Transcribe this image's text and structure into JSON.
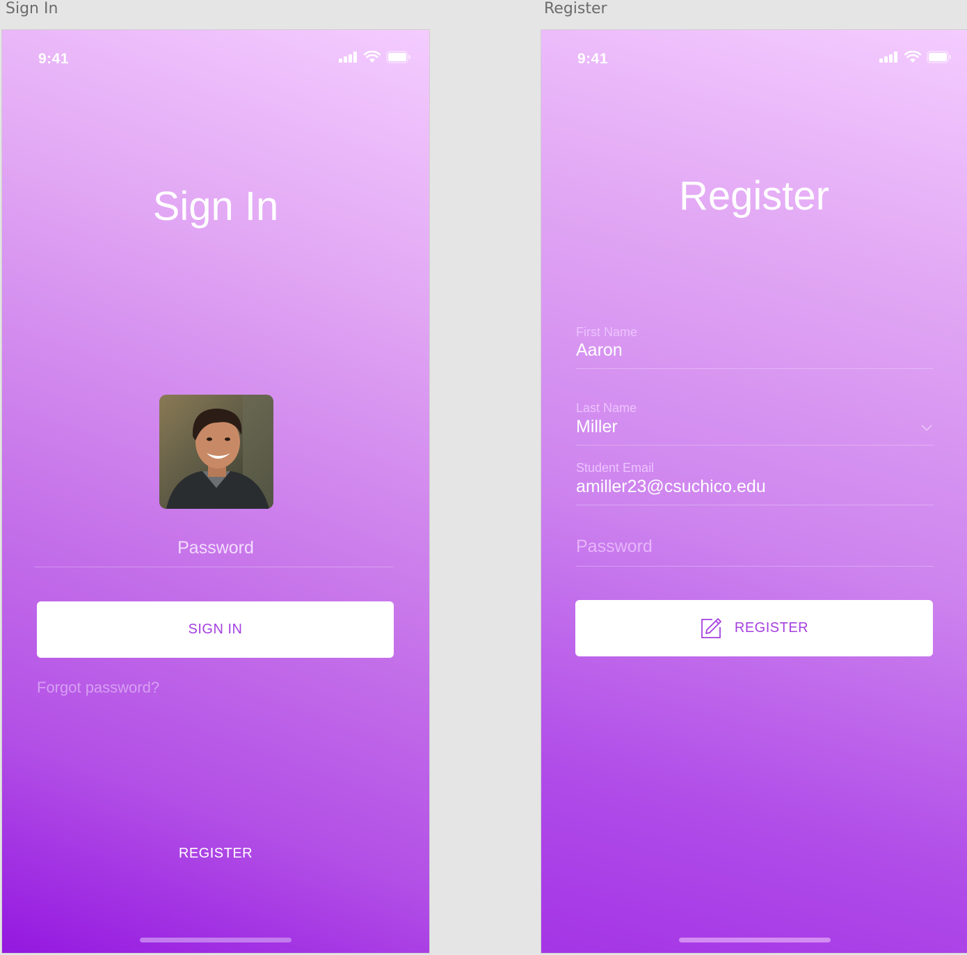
{
  "artboards": {
    "signin_label": "Sign In",
    "register_label": "Register"
  },
  "status_bar": {
    "time": "9:41"
  },
  "signin": {
    "title": "Sign In",
    "password_placeholder": "Password",
    "sign_in_button": "SIGN IN",
    "forgot_link": "Forgot password?",
    "register_link": "REGISTER"
  },
  "register": {
    "title": "Register",
    "first_name": {
      "label": "First Name",
      "value": "Aaron"
    },
    "last_name": {
      "label": "Last Name",
      "value": "Miller"
    },
    "email": {
      "label": "Student Email",
      "value": "amiller23@csuchico.edu"
    },
    "password_placeholder": "Password",
    "register_button": "REGISTER"
  },
  "colors": {
    "accent": "#a43fe0",
    "gradient_top": "#f4ccff",
    "gradient_bottom": "#9418e0"
  },
  "icons": [
    "cellular-signal-icon",
    "wifi-icon",
    "battery-icon",
    "edit-icon",
    "chevron-down-icon"
  ]
}
